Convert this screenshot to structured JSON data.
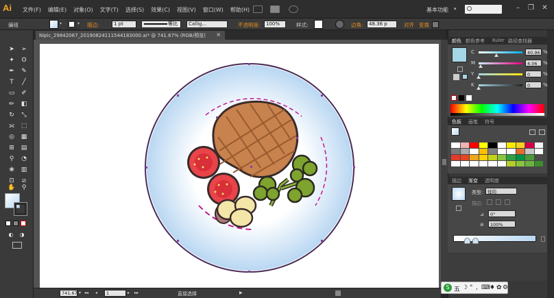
{
  "app": {
    "logo": "Ai",
    "menu": [
      "文件(F)",
      "编辑(E)",
      "对象(O)",
      "文字(T)",
      "选择(S)",
      "效果(C)",
      "视图(V)",
      "窗口(W)",
      "帮助(H)"
    ],
    "workspace": "基本功能",
    "workspace_chevron": "▾"
  },
  "control_bar": {
    "selection": "编组",
    "stroke_label": "描边:",
    "stroke_weight": "1 pt",
    "profile": "等比",
    "brush": "Callig...",
    "opacity_label": "不透明度:",
    "opacity": "100%",
    "style_label": "样式:",
    "corner_label": "边角:",
    "corner_value": "48.36 p",
    "align_label": "对齐",
    "transform_label": "变换"
  },
  "document": {
    "tab_title": "Nipic_29842067_20190824111544183000.ai* @ 741.67% (RGB/预览)",
    "close": "×"
  },
  "status_bar": {
    "zoom": "741.67",
    "artboard": "1",
    "tool_label": "直接选择",
    "nav_first": "◂◂",
    "nav_prev": "◂",
    "nav_next": "▸",
    "nav_last": "▸▸",
    "play": "▶"
  },
  "color_panel": {
    "tabs": [
      "颜色",
      "颜色参考",
      "Kuler",
      "路径查找器"
    ],
    "channels": [
      {
        "label": "C",
        "value": "40.96",
        "pct": "%",
        "color": "#00aee8"
      },
      {
        "label": "M",
        "value": "4.06",
        "pct": "%",
        "color": "#e6007e"
      },
      {
        "label": "Y",
        "value": "0",
        "pct": "%",
        "color": "#ffe600"
      },
      {
        "label": "K",
        "value": "0",
        "pct": "%",
        "color": "#222222"
      }
    ],
    "channel_levels": [
      0.41,
      0.04,
      0.0,
      0.0
    ]
  },
  "swatches_panel": {
    "tabs": [
      "色板",
      "画笔",
      "符号"
    ],
    "colors": [
      "#ffffff",
      "#f2b3b3",
      "#ff0000",
      "#ffff00",
      "#000000",
      "#ffffff",
      "#ffeb00",
      "#f7d31e",
      "#d40049",
      "#f5f5f5",
      "#7a7a7a",
      "#aaaaaa",
      "#ffffff",
      "#ffbf00",
      "#7f7f7f",
      "#ffffff",
      "#ffffff",
      "#e36e2b",
      "#c8c8c8",
      "#ffffff",
      "#e23b2b",
      "#e64621",
      "#f0a51e",
      "#ffd200",
      "#c6d21a",
      "#8bc53f",
      "#2da143",
      "#009245",
      "#4a9a3a",
      "#4a4a4a",
      "#ffffff",
      "#ffffff",
      "#ffffff",
      "#ffffff",
      "#ffffff",
      "#ffffff",
      "#b4cf2a",
      "#8bc53f",
      "#6db33f",
      "#3e8e2e"
    ]
  },
  "gradient_panel": {
    "tabs": [
      "描边",
      "渐变",
      "透明度"
    ],
    "type_label": "类型:",
    "type_value": "径向",
    "stroke_label": "描边:",
    "angle": "0°",
    "aspect": "100%"
  },
  "taskbar": {
    "items": [
      "S",
      "五",
      "☽",
      "°",
      ",",
      "⌨",
      "♦",
      "✿",
      "⚙"
    ]
  }
}
